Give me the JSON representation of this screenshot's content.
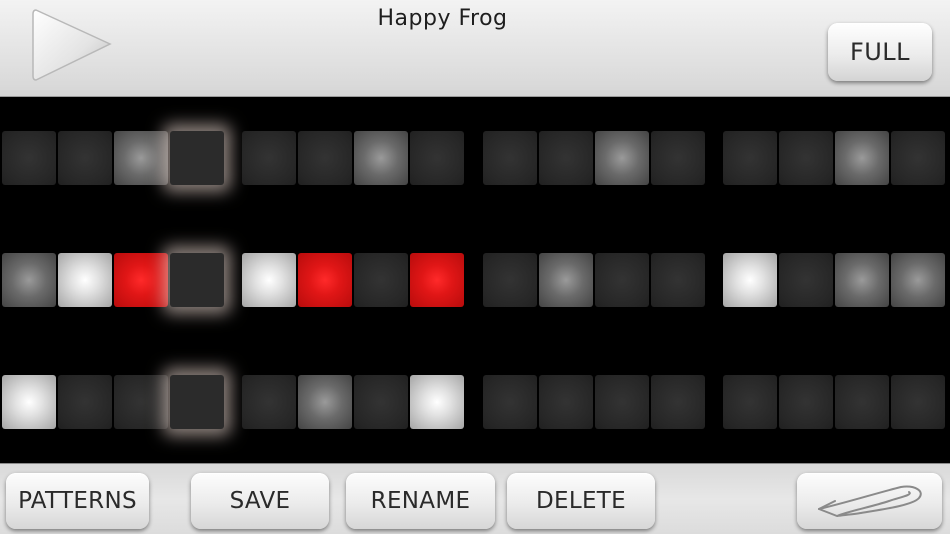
{
  "header": {
    "title": "Happy Frog",
    "full_label": "FULL",
    "play_icon": "play-icon"
  },
  "sequencer": {
    "current_step": 4,
    "pad_states_legend": [
      "off",
      "low",
      "high",
      "accent-red"
    ],
    "rows": [
      [
        0,
        0,
        1,
        0,
        0,
        0,
        1,
        0,
        0,
        0,
        1,
        0,
        0,
        0,
        1,
        0
      ],
      [
        1,
        2,
        3,
        0,
        2,
        3,
        0,
        3,
        0,
        1,
        0,
        0,
        2,
        0,
        1,
        1
      ],
      [
        2,
        0,
        0,
        0,
        0,
        1,
        0,
        2,
        0,
        0,
        0,
        0,
        0,
        0,
        0,
        0
      ]
    ],
    "colors": {
      "accent": "#e01616",
      "pad_off": "#262626",
      "background": "#000000"
    }
  },
  "footer": {
    "patterns_label": "PATTERNS",
    "save_label": "SAVE",
    "rename_label": "RENAME",
    "delete_label": "DELETE",
    "back_icon": "back-arrow-icon"
  }
}
